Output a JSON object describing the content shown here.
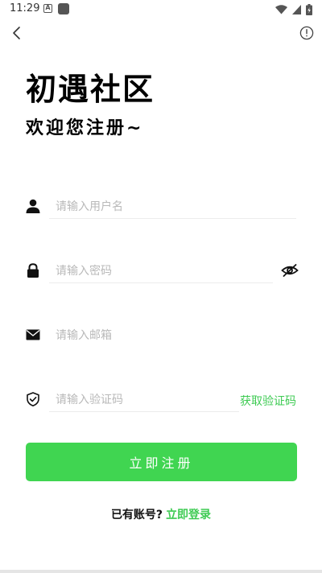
{
  "status_bar": {
    "time": "11:29",
    "left_icons": [
      "a-badge-icon",
      "square-app-icon"
    ],
    "right_icons": [
      "wifi-icon",
      "signal-icon",
      "battery-charging-icon"
    ]
  },
  "header": {
    "back_icon": "chevron-left-icon",
    "info_icon": "info-circle-icon"
  },
  "titles": {
    "title": "初遇社区",
    "subtitle": "欢迎您注册~"
  },
  "form": {
    "username": {
      "placeholder": "请输入用户名",
      "value": "",
      "icon": "user-icon"
    },
    "password": {
      "placeholder": "请输入密码",
      "value": "",
      "icon": "lock-icon",
      "toggle_icon": "eye-off-icon"
    },
    "email": {
      "placeholder": "请输入邮箱",
      "value": "",
      "icon": "mail-icon"
    },
    "code": {
      "placeholder": "请输入验证码",
      "value": "",
      "icon": "shield-check-icon",
      "get_code_label": "获取验证码"
    }
  },
  "register_button": {
    "label": "立即注册"
  },
  "login_prompt": {
    "question": "已有账号?",
    "link": "立即登录"
  },
  "colors": {
    "accent": "#40d551",
    "accent_text": "#3ecb53",
    "placeholder": "#b9b9b9",
    "divider": "#ececec"
  }
}
